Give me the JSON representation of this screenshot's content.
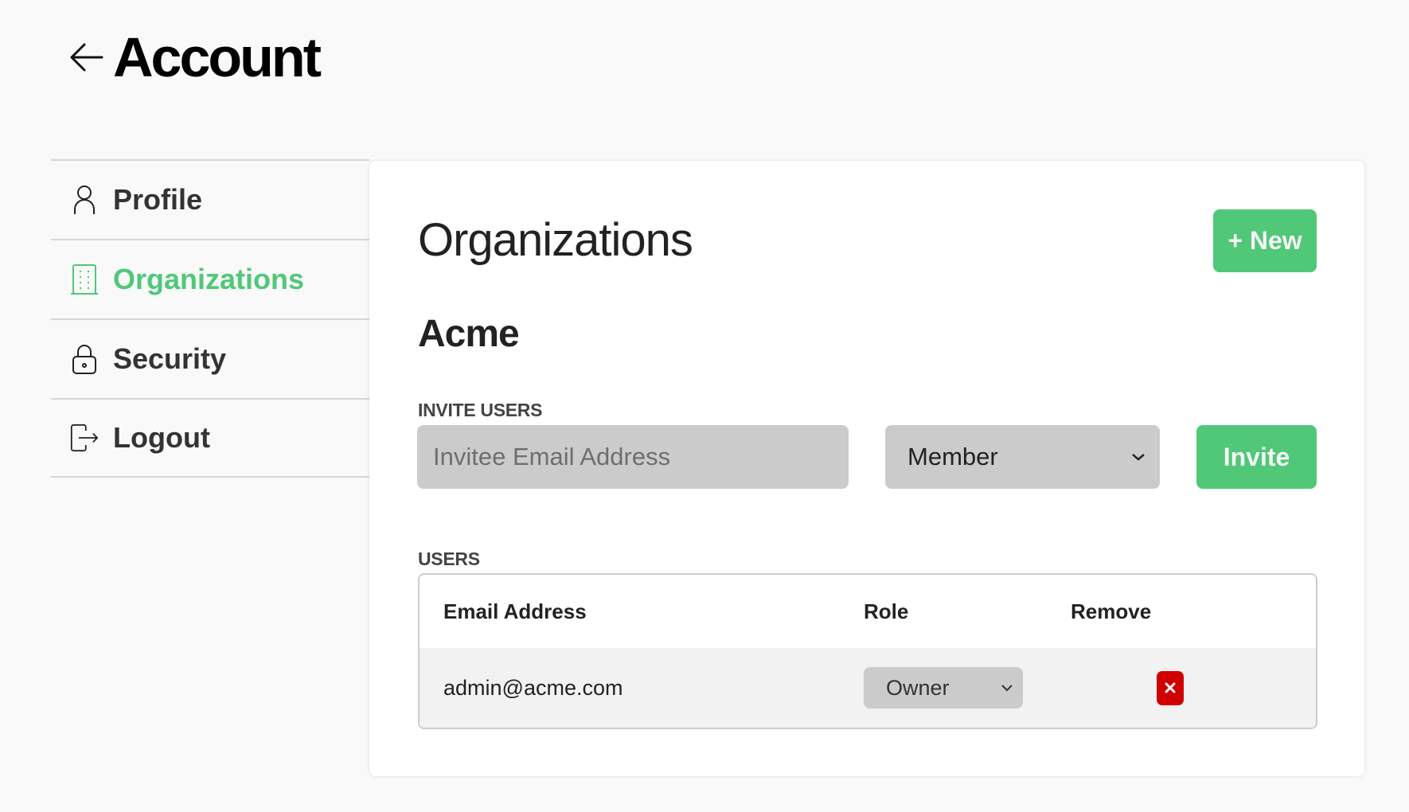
{
  "header": {
    "title": "Account",
    "back_icon": "arrow-left-icon"
  },
  "sidebar": {
    "items": [
      {
        "label": "Profile",
        "icon": "user-icon",
        "active": false
      },
      {
        "label": "Organizations",
        "icon": "building-icon",
        "active": true
      },
      {
        "label": "Security",
        "icon": "lock-icon",
        "active": false
      },
      {
        "label": "Logout",
        "icon": "logout-icon",
        "active": false
      }
    ]
  },
  "main": {
    "title": "Organizations",
    "new_button_label": "+ New",
    "org_name": "Acme",
    "invite": {
      "section_label": "INVITE USERS",
      "email_placeholder": "Invitee Email Address",
      "email_value": "",
      "role_selected": "Member",
      "invite_button_label": "Invite"
    },
    "users": {
      "section_label": "USERS",
      "columns": [
        "Email Address",
        "Role",
        "Remove"
      ],
      "rows": [
        {
          "email": "admin@acme.com",
          "role": "Owner",
          "remove_icon": "close-icon"
        }
      ]
    }
  },
  "colors": {
    "accent": "#50c878",
    "danger": "#d00000",
    "background": "#f9f9f9",
    "input_bg": "#cbcbcb"
  }
}
